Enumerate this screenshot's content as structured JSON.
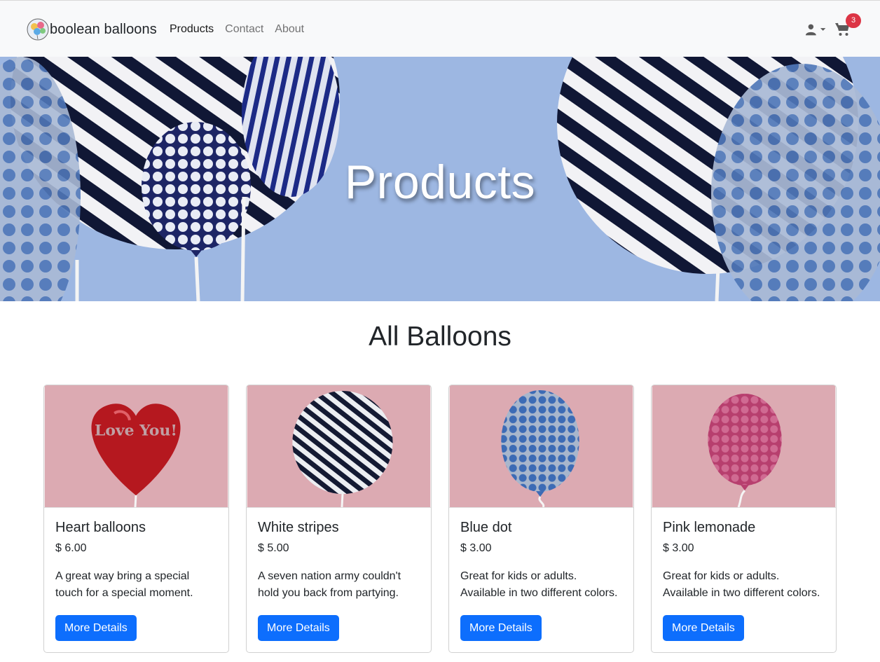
{
  "brand": {
    "name": "boolean balloons",
    "logo_icon": "balloons-logo-icon"
  },
  "nav": {
    "links": [
      {
        "label": "Products",
        "active": true
      },
      {
        "label": "Contact",
        "active": false
      },
      {
        "label": "About",
        "active": false
      }
    ],
    "user_icon": "user-icon",
    "cart_icon": "cart-icon",
    "cart_count": "3"
  },
  "hero": {
    "title": "Products"
  },
  "section": {
    "title": "All Balloons"
  },
  "products": [
    {
      "name": "Heart balloons",
      "price": "$ 6.00",
      "description": "A great way bring a special touch for a special moment.",
      "button": "More Details",
      "image_text": "Love You!"
    },
    {
      "name": "White stripes",
      "price": "$ 5.00",
      "description": "A seven nation army couldn't hold you back from partying.",
      "button": "More Details"
    },
    {
      "name": "Blue dot",
      "price": "$ 3.00",
      "description": "Great for kids or adults. Available in two different colors.",
      "button": "More Details"
    },
    {
      "name": "Pink lemonade",
      "price": "$ 3.00",
      "description": "Great for kids or adults. Available in two different colors.",
      "button": "More Details"
    }
  ],
  "colors": {
    "primary": "#0d6efd",
    "badge": "#dc3545",
    "navbar_bg": "#f8f9fa",
    "hero_sky": "#9db7e2",
    "card_image_bg": "#dcaab2"
  }
}
